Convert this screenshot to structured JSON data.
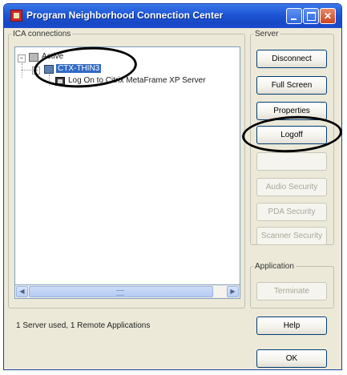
{
  "window": {
    "title": "Program Neighborhood Connection Center",
    "controls": {
      "minimize": "",
      "maximize": "",
      "close": "✕"
    }
  },
  "ica_connections": {
    "label": "ICA connections",
    "tree": [
      {
        "expander": "−",
        "label": "Active"
      },
      {
        "expander": "−",
        "label": "CTX-THIN3",
        "selected": true
      },
      {
        "label": "Log On to Citrix MetaFrame XP Server"
      }
    ],
    "scrollbar": {
      "left_arrow": "◀",
      "right_arrow": "▶"
    }
  },
  "server_group": {
    "label": "Server",
    "buttons": [
      {
        "label": "Disconnect",
        "enabled": true
      },
      {
        "label": "Full Screen",
        "enabled": true
      },
      {
        "label": "Properties",
        "enabled": true
      },
      {
        "label": "Logoff",
        "enabled": true
      },
      {
        "label": "",
        "enabled": false
      },
      {
        "label": "Audio Security",
        "enabled": false
      },
      {
        "label": "PDA Security",
        "enabled": false
      },
      {
        "label": "Scanner Security",
        "enabled": false
      }
    ]
  },
  "application_group": {
    "label": "Application",
    "buttons": [
      {
        "label": "Terminate",
        "enabled": false
      }
    ]
  },
  "status": "1 Server used, 1 Remote Applications",
  "help_label": "Help",
  "ok_label": "OK"
}
